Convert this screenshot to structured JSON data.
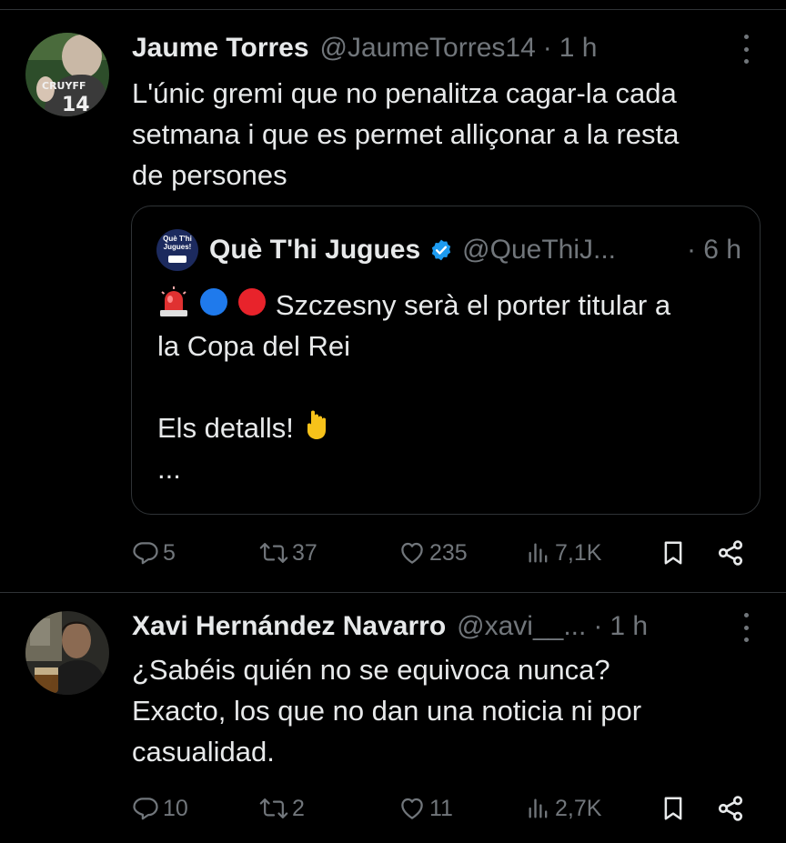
{
  "tweets": [
    {
      "name": "Jaume Torres",
      "handle": "@JaumeTorres14",
      "time": "1 h",
      "text_lines": [
        "L'únic gremi que no penalitza cagar-la cada",
        "setmana i que es permet alliçonar a la resta",
        "de persones"
      ],
      "avatar_text": "CRUYFF",
      "quote": {
        "avatar_text": "Què T'hi Jugues!",
        "name": "Què T'hi Jugues",
        "handle": "@QueThiJ...",
        "time": "6 h",
        "line1_text": "Szczesny serà el porter titular a",
        "line2": "la Copa del Rei",
        "line3": "Els detalls!",
        "line4": "..."
      },
      "actions": {
        "replies": "5",
        "retweets": "37",
        "likes": "235",
        "views": "7,1K"
      }
    },
    {
      "name": "Xavi Hernández Navarro",
      "handle": "@xavi__...",
      "time": "1 h",
      "text_lines": [
        "¿Sabéis quién no se equivoca nunca?",
        "Exacto, los que no dan una noticia ni por",
        "casualidad."
      ],
      "actions": {
        "replies": "10",
        "retweets": "2",
        "likes": "11",
        "views": "2,7K"
      }
    }
  ],
  "separator": "·",
  "colors": {
    "background": "#000000",
    "text": "#e7e9ea",
    "muted": "#71767b",
    "border": "#2f3336",
    "verified": "#1d9bf0"
  }
}
